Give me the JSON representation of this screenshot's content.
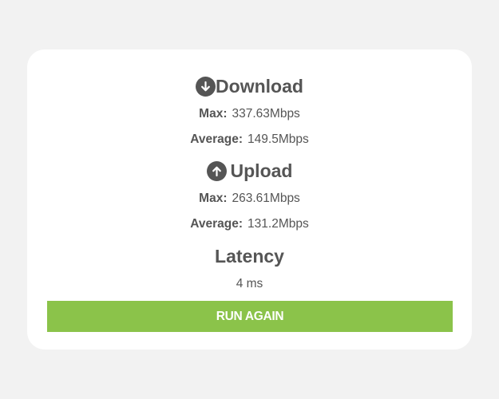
{
  "download": {
    "title": "Download",
    "icon": "arrow-down-circle-icon",
    "max_label": "Max:",
    "max_value": "337.63Mbps",
    "avg_label": "Average:",
    "avg_value": "149.5Mbps"
  },
  "upload": {
    "title": "Upload",
    "icon": "arrow-up-circle-icon",
    "max_label": "Max:",
    "max_value": "263.61Mbps",
    "avg_label": "Average:",
    "avg_value": "131.2Mbps"
  },
  "latency": {
    "title": "Latency",
    "value": "4 ms"
  },
  "actions": {
    "run_again_label": "RUN AGAIN"
  },
  "colors": {
    "accent": "#8bc34a",
    "text": "#555555",
    "card": "#ffffff",
    "background": "#f2f2f2"
  }
}
